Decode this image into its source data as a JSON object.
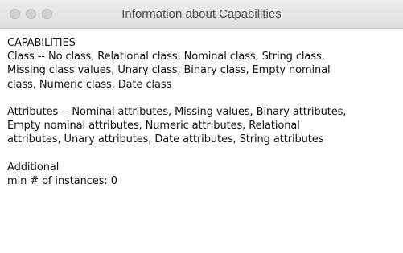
{
  "window": {
    "title": "Information about Capabilities"
  },
  "controls": {
    "close_icon": "close-icon",
    "minimize_icon": "minimize-icon",
    "zoom_icon": "zoom-icon",
    "button_color": "#d1d1d1"
  },
  "info": {
    "heading": "CAPABILITIES",
    "class_lines": [
      "Class -- No class, Relational class, Nominal class, String class,",
      "Missing class values, Unary class, Binary class, Empty nominal",
      "class, Numeric class, Date class"
    ],
    "attribute_lines": [
      "Attributes -- Nominal attributes, Missing values, Binary attributes,",
      "Empty nominal attributes, Numeric attributes, Relational",
      "attributes, Unary attributes, Date attributes, String attributes"
    ],
    "additional_heading": "Additional",
    "min_instances": "min # of instances: 0"
  }
}
